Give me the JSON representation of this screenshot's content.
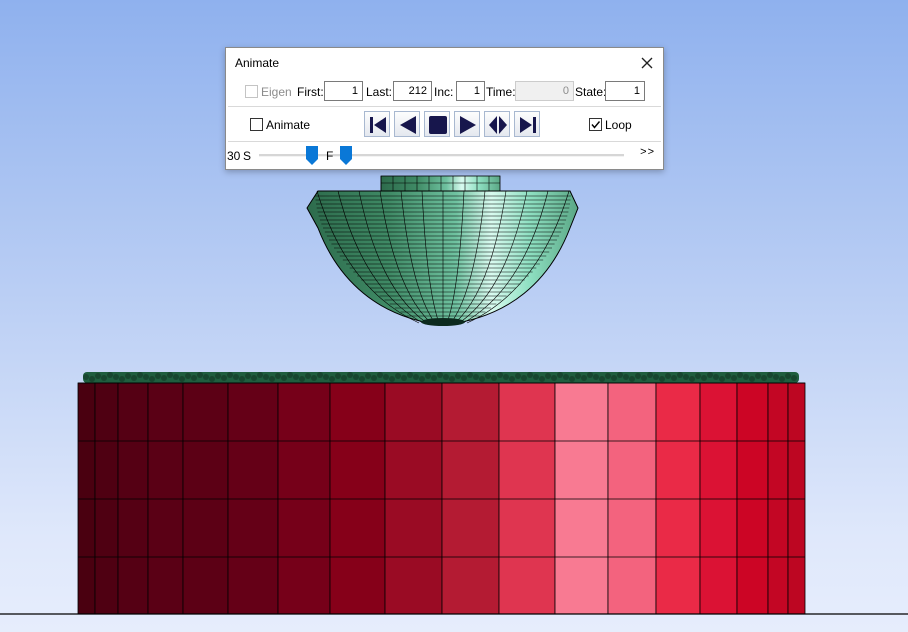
{
  "dialog": {
    "title": "Animate",
    "eigen_label": "Eigen",
    "eigen_checked": false,
    "first_label": "First:",
    "first_value": "1",
    "last_label": "Last:",
    "last_value": "212",
    "inc_label": "Inc:",
    "inc_value": "1",
    "time_label": "Time:",
    "time_value": "0",
    "state_label": "State:",
    "state_value": "1",
    "animate_label": "Animate",
    "animate_checked": false,
    "loop_label": "Loop",
    "loop_checked": true,
    "playback_buttons": [
      "first-frame-icon",
      "step-back-icon",
      "stop-icon",
      "play-icon",
      "step-both-icon",
      "last-frame-icon"
    ],
    "speed_label": "30",
    "slow_label": "S",
    "fast_label": "F",
    "more_label": ">>"
  },
  "colors": {
    "button_glyph": "#17164c",
    "slider_thumb": "#0a78d7",
    "mesh_line": "#000000"
  }
}
